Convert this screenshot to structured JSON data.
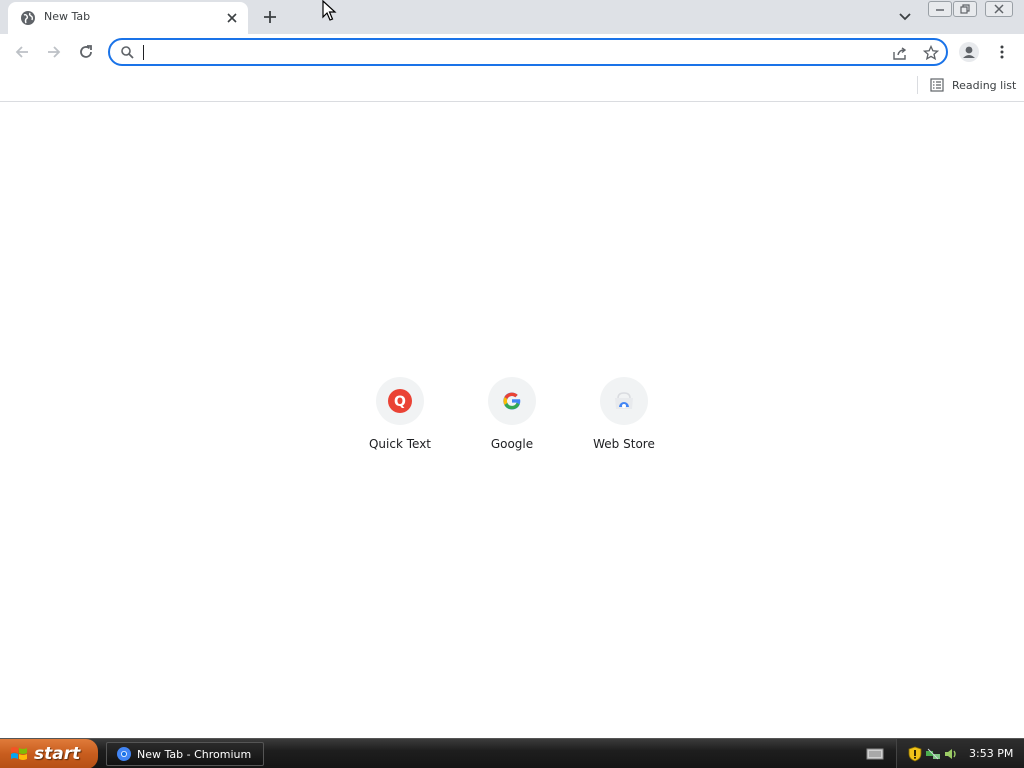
{
  "browser": {
    "tab": {
      "title": "New Tab"
    },
    "omnibox": {
      "value": "",
      "placeholder": ""
    },
    "bookmarks_bar": {
      "reading_list_label": "Reading list"
    }
  },
  "ntp": {
    "shortcuts": [
      {
        "label": "Quick Text",
        "icon": "quick-text-q-icon",
        "color": "#ea4335",
        "glyph": "Q"
      },
      {
        "label": "Google",
        "icon": "google-g-icon",
        "glyph": "G"
      },
      {
        "label": "Web Store",
        "icon": "web-store-icon"
      }
    ]
  },
  "taskbar": {
    "start_label": "start",
    "task": {
      "label": "New Tab - Chromium"
    },
    "clock": "3:53 PM"
  },
  "colors": {
    "accent": "#1a73e8",
    "tabstrip": "#dee1e6",
    "start_button": "#c85d1e"
  }
}
